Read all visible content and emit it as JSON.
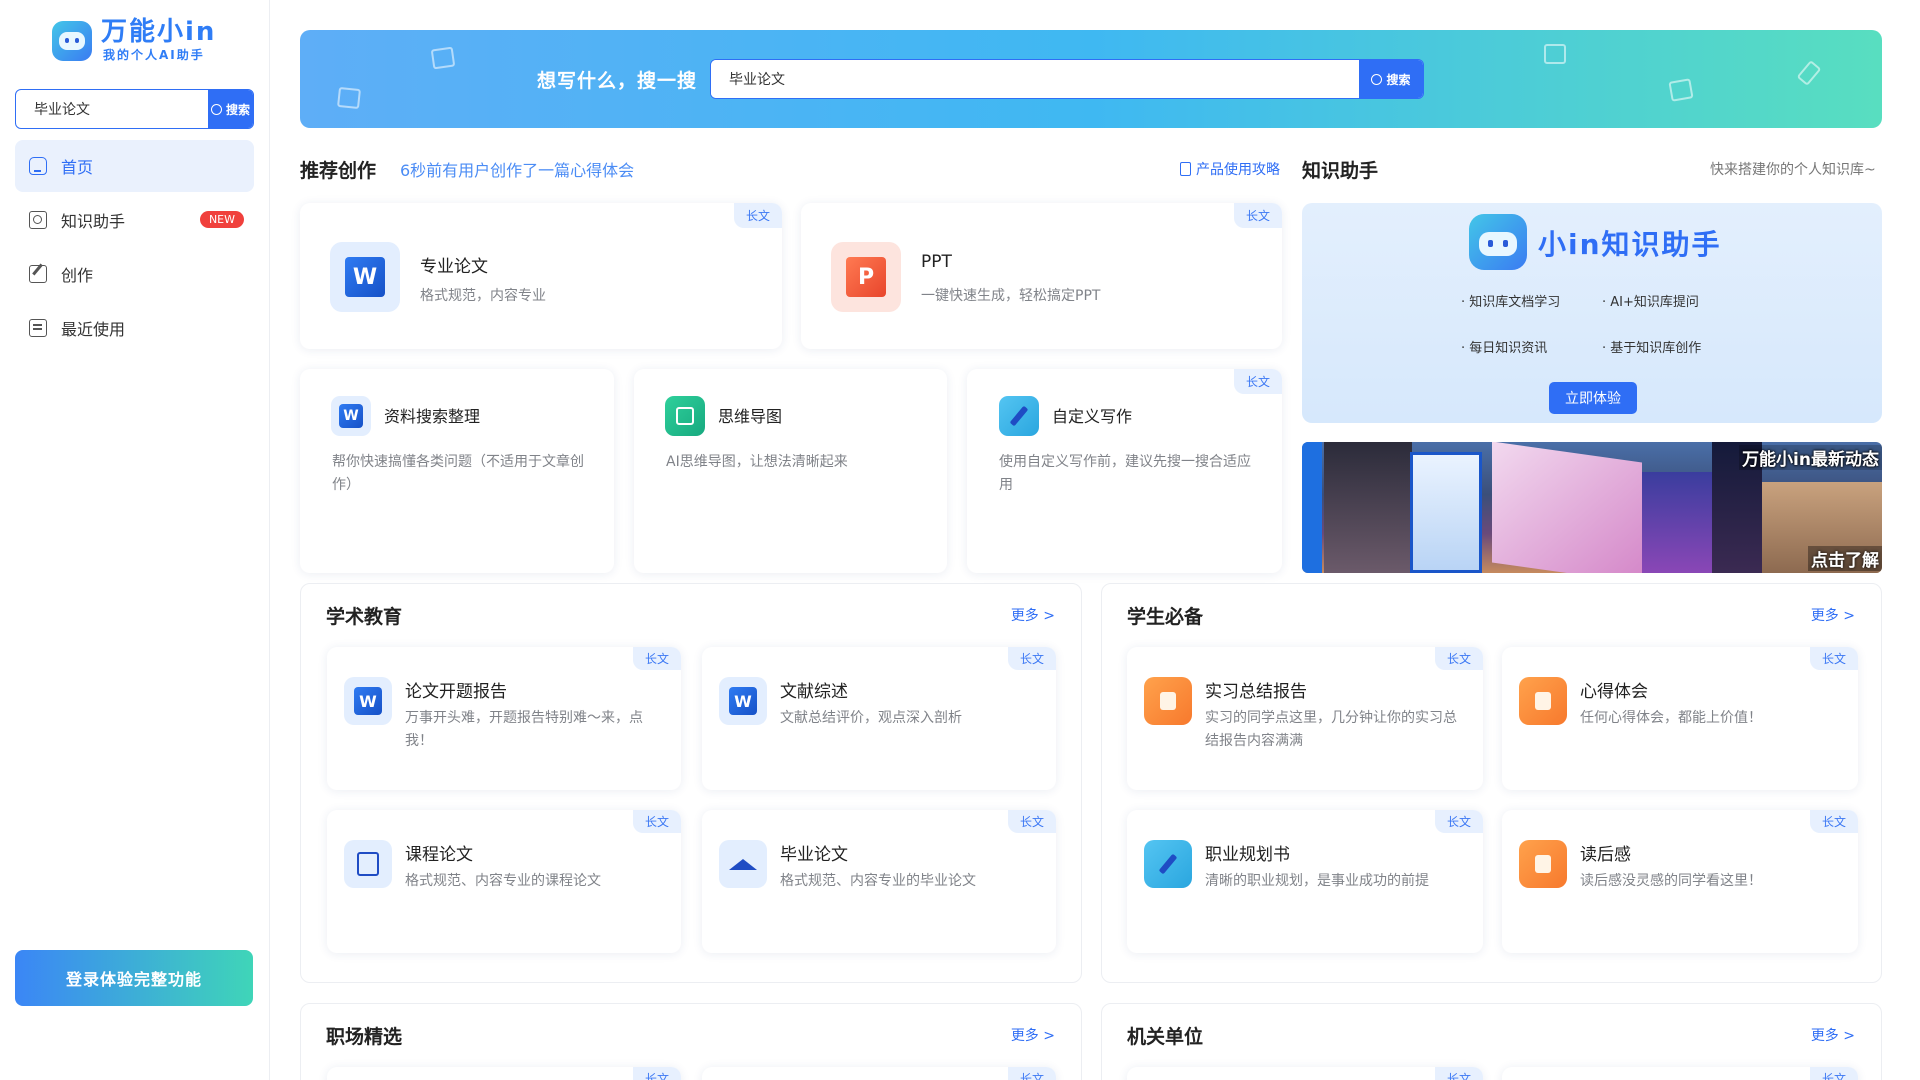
{
  "sidebar": {
    "logo_title": "万能小in",
    "logo_sub": "我的个人AI助手",
    "search_value": "毕业论文",
    "search_button": "搜索",
    "nav": [
      {
        "label": "首页",
        "icon": "home-icon"
      },
      {
        "label": "知识助手",
        "icon": "knowledge-icon",
        "badge": "NEW"
      },
      {
        "label": "创作",
        "icon": "edit-icon"
      },
      {
        "label": "最近使用",
        "icon": "recent-icon"
      }
    ],
    "login_button": "登录体验完整功能"
  },
  "banner": {
    "label": "想写什么，搜一搜",
    "search_value": "毕业论文",
    "search_button": "搜索"
  },
  "recommend": {
    "title": "推荐创作",
    "note": "6秒前有用户创作了一篇心得体会",
    "guide_link": "产品使用攻略",
    "tag": "长文",
    "cards": [
      {
        "title": "专业论文",
        "desc": "格式规范，内容专业",
        "tag": "长文"
      },
      {
        "title": "PPT",
        "desc": "一键快速生成，轻松搞定PPT",
        "tag": "长文"
      },
      {
        "title": "资料搜索整理",
        "desc": "帮你快速搞懂各类问题（不适用于文章创作）"
      },
      {
        "title": "思维导图",
        "desc": "AI思维导图，让想法清晰起来"
      },
      {
        "title": "自定义写作",
        "desc": "使用自定义写作前，建议先搜一搜合适应用",
        "tag": "长文"
      }
    ]
  },
  "knowledge": {
    "title": "知识助手",
    "note": "快来搭建你的个人知识库~",
    "panel_title": "小in知识助手",
    "features": [
      "· 知识库文档学习",
      "· AI+知识库提问",
      "· 每日知识资讯",
      "· 基于知识库创作"
    ],
    "button": "立即体验"
  },
  "photo_banner": {
    "caption": "万能小in最新动态",
    "caption2": "点击了解"
  },
  "academic": {
    "title": "学术教育",
    "more": "更多 >",
    "cards": [
      {
        "title": "论文开题报告",
        "desc": "万事开头难，开题报告特别难～来，点我！",
        "tag": "长文"
      },
      {
        "title": "文献综述",
        "desc": "文献总结评价，观点深入剖析",
        "tag": "长文"
      },
      {
        "title": "课程论文",
        "desc": "格式规范、内容专业的课程论文",
        "tag": "长文"
      },
      {
        "title": "毕业论文",
        "desc": "格式规范、内容专业的毕业论文",
        "tag": "长文"
      }
    ]
  },
  "student": {
    "title": "学生必备",
    "more": "更多 >",
    "cards": [
      {
        "title": "实习总结报告",
        "desc": "实习的同学点这里，几分钟让你的实习总结报告内容满满",
        "tag": "长文"
      },
      {
        "title": "心得体会",
        "desc": "任何心得体会，都能上价值！",
        "tag": "长文"
      },
      {
        "title": "职业规划书",
        "desc": "清晰的职业规划，是事业成功的前提",
        "tag": "长文"
      },
      {
        "title": "读后感",
        "desc": "读后感没灵感的同学看这里！",
        "tag": "长文"
      }
    ]
  },
  "workplace": {
    "title": "职场精选",
    "more": "更多 >",
    "tag": "长文"
  },
  "government": {
    "title": "机关单位",
    "more": "更多 >",
    "tag": "长文"
  }
}
